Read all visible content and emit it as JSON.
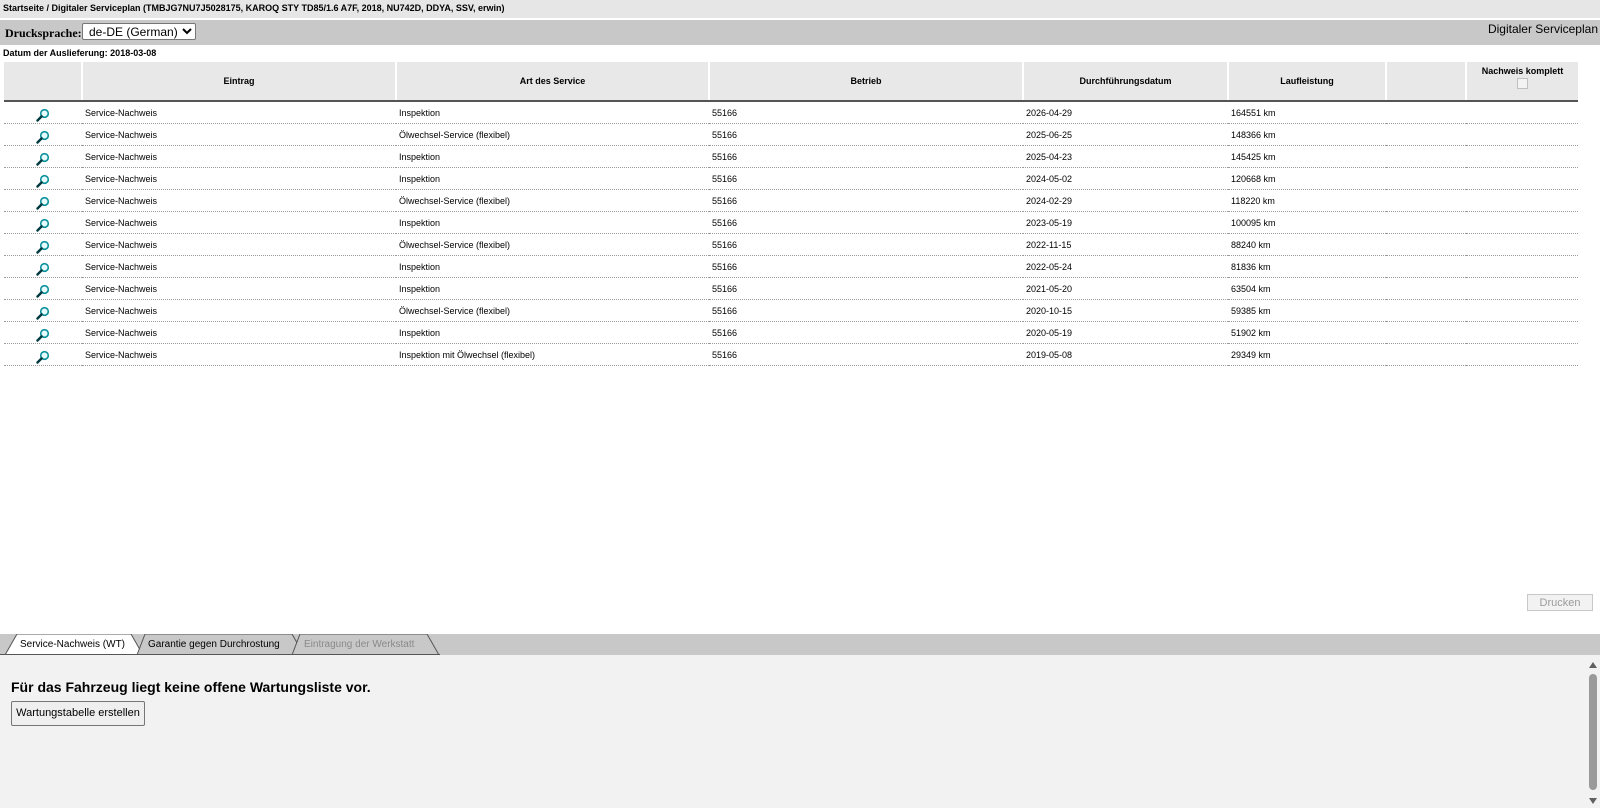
{
  "breadcrumb": "Startseite / Digitaler Serviceplan (TMBJG7NU7J5028175, KAROQ STY TD85/1.6 A7F, 2018, NU742D, DDYA, SSV, erwin)",
  "toolbar": {
    "language_label": "Drucksprache:",
    "language_selected": "de-DE (German)",
    "title": "Digitaler Serviceplan"
  },
  "delivery_date": "Datum der Auslieferung: 2018-03-08",
  "table": {
    "headers": {
      "entry": "Eintrag",
      "service_type": "Art des Service",
      "workshop": "Betrieb",
      "date": "Durchführungsdatum",
      "mileage": "Laufleistung",
      "proof_complete": "Nachweis komplett"
    },
    "rows": [
      {
        "entry": "Service-Nachweis",
        "service_type": "Inspektion",
        "workshop": "55166",
        "date": "2026-04-29",
        "mileage": "164551 km"
      },
      {
        "entry": "Service-Nachweis",
        "service_type": "Ölwechsel-Service (flexibel)",
        "workshop": "55166",
        "date": "2025-06-25",
        "mileage": "148366 km"
      },
      {
        "entry": "Service-Nachweis",
        "service_type": "Inspektion",
        "workshop": "55166",
        "date": "2025-04-23",
        "mileage": "145425 km"
      },
      {
        "entry": "Service-Nachweis",
        "service_type": "Inspektion",
        "workshop": "55166",
        "date": "2024-05-02",
        "mileage": "120668 km"
      },
      {
        "entry": "Service-Nachweis",
        "service_type": "Ölwechsel-Service (flexibel)",
        "workshop": "55166",
        "date": "2024-02-29",
        "mileage": "118220 km"
      },
      {
        "entry": "Service-Nachweis",
        "service_type": "Inspektion",
        "workshop": "55166",
        "date": "2023-05-19",
        "mileage": "100095 km"
      },
      {
        "entry": "Service-Nachweis",
        "service_type": "Ölwechsel-Service (flexibel)",
        "workshop": "55166",
        "date": "2022-11-15",
        "mileage": "88240 km"
      },
      {
        "entry": "Service-Nachweis",
        "service_type": "Inspektion",
        "workshop": "55166",
        "date": "2022-05-24",
        "mileage": "81836 km"
      },
      {
        "entry": "Service-Nachweis",
        "service_type": "Inspektion",
        "workshop": "55166",
        "date": "2021-05-20",
        "mileage": "63504 km"
      },
      {
        "entry": "Service-Nachweis",
        "service_type": "Ölwechsel-Service (flexibel)",
        "workshop": "55166",
        "date": "2020-10-15",
        "mileage": "59385 km"
      },
      {
        "entry": "Service-Nachweis",
        "service_type": "Inspektion",
        "workshop": "55166",
        "date": "2020-05-19",
        "mileage": "51902 km"
      },
      {
        "entry": "Service-Nachweis",
        "service_type": "Inspektion mit Ölwechsel (flexibel)",
        "workshop": "55166",
        "date": "2019-05-08",
        "mileage": "29349 km"
      }
    ]
  },
  "print_button": "Drucken",
  "tabs": [
    {
      "label": "Service-Nachweis (WT)",
      "state": "active"
    },
    {
      "label": "Garantie gegen Durchrostung",
      "state": "normal"
    },
    {
      "label": "Eintragung der Werkstatt",
      "state": "disabled"
    }
  ],
  "bottom": {
    "message": "Für das Fahrzeug liegt keine offene Wartungsliste vor.",
    "create_button": "Wartungstabelle erstellen"
  },
  "icons": {
    "details": "magnifier-icon",
    "scroll_up": "arrow-up-icon",
    "scroll_down": "arrow-down-icon"
  },
  "colors": {
    "toolbar_bg": "#c8c8c8",
    "header_bg": "#e8e8e8",
    "icon_teal": "#0b8f9a",
    "bottom_bg": "#f2f2f2"
  }
}
